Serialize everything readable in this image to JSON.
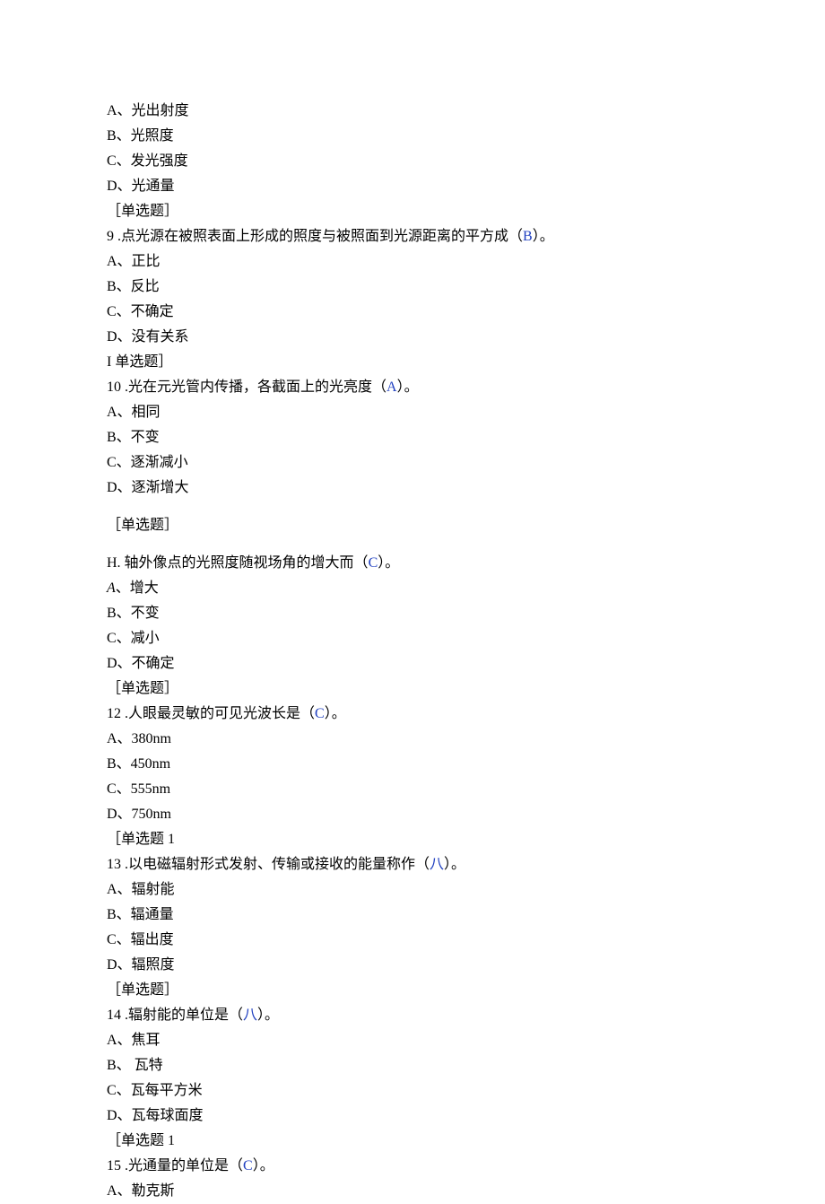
{
  "lines": [
    {
      "segments": [
        {
          "text": "A、光出射度"
        }
      ]
    },
    {
      "segments": [
        {
          "text": "B、光照度"
        }
      ]
    },
    {
      "segments": [
        {
          "text": "C、发光强度"
        }
      ]
    },
    {
      "segments": [
        {
          "text": "D、光通量"
        }
      ]
    },
    {
      "segments": [
        {
          "text": "［单选题］"
        }
      ]
    },
    {
      "segments": [
        {
          "text": "9 .点光源在被照表面上形成的照度与被照面到光源距离的平方成（"
        },
        {
          "text": "B",
          "blue": true
        },
        {
          "text": "）。"
        }
      ]
    },
    {
      "segments": [
        {
          "text": "A、正比"
        }
      ]
    },
    {
      "segments": [
        {
          "text": "B、反比"
        }
      ]
    },
    {
      "segments": [
        {
          "text": "C、不确定"
        }
      ]
    },
    {
      "segments": [
        {
          "text": "D、没有关系"
        }
      ]
    },
    {
      "segments": [
        {
          "text": "I 单选题］"
        }
      ]
    },
    {
      "segments": [
        {
          "text": "10 .光在元光管内传播，各截面上的光亮度（"
        },
        {
          "text": "A",
          "blue": true
        },
        {
          "text": "）。"
        }
      ]
    },
    {
      "segments": [
        {
          "text": "A、相同"
        }
      ]
    },
    {
      "segments": [
        {
          "text": "B、不变"
        }
      ]
    },
    {
      "segments": [
        {
          "text": "C、逐渐减小"
        }
      ]
    },
    {
      "segments": [
        {
          "text": "D、逐渐增大"
        }
      ]
    },
    {
      "gap": true,
      "segments": [
        {
          "text": "［单选题］"
        }
      ]
    },
    {
      "gap": true,
      "segments": [
        {
          "text": "H. 轴外像点的光照度随视场角的增大而（"
        },
        {
          "text": "C",
          "blue": true
        },
        {
          "text": "）。"
        }
      ]
    },
    {
      "segments": [
        {
          "text": "A",
          "italic": true
        },
        {
          "text": "、增大"
        }
      ]
    },
    {
      "segments": [
        {
          "text": "B、不变"
        }
      ]
    },
    {
      "segments": [
        {
          "text": "C、减小"
        }
      ]
    },
    {
      "segments": [
        {
          "text": "D、不确定"
        }
      ]
    },
    {
      "segments": [
        {
          "text": "［单选题］"
        }
      ]
    },
    {
      "segments": [
        {
          "text": "12 .人眼最灵敏的可见光波长是（"
        },
        {
          "text": "C",
          "blue": true
        },
        {
          "text": "）。"
        }
      ]
    },
    {
      "segments": [
        {
          "text": "A、380nm"
        }
      ]
    },
    {
      "segments": [
        {
          "text": "B、450nm"
        }
      ]
    },
    {
      "segments": [
        {
          "text": "C、555nm"
        }
      ]
    },
    {
      "segments": [
        {
          "text": "D、750nm"
        }
      ]
    },
    {
      "segments": [
        {
          "text": "［单选题 1"
        }
      ]
    },
    {
      "segments": [
        {
          "text": "13 .以电磁辐射形式发射、传输或接收的能量称作（"
        },
        {
          "text": "八",
          "blue": true
        },
        {
          "text": "）。"
        }
      ]
    },
    {
      "segments": [
        {
          "text": "A、辐射能"
        }
      ]
    },
    {
      "segments": [
        {
          "text": "B、辐通量"
        }
      ]
    },
    {
      "segments": [
        {
          "text": "C、辐出度"
        }
      ]
    },
    {
      "segments": [
        {
          "text": "D、辐照度"
        }
      ]
    },
    {
      "segments": [
        {
          "text": "［单选题］"
        }
      ]
    },
    {
      "segments": [
        {
          "text": "14 .辐射能的单位是（"
        },
        {
          "text": "八",
          "blue": true
        },
        {
          "text": "）。"
        }
      ]
    },
    {
      "segments": [
        {
          "text": "A、焦耳"
        }
      ]
    },
    {
      "segments": [
        {
          "text": "B、 瓦特"
        }
      ]
    },
    {
      "segments": [
        {
          "text": "C、瓦每平方米"
        }
      ]
    },
    {
      "segments": [
        {
          "text": "D、瓦每球面度"
        }
      ]
    },
    {
      "segments": [
        {
          "text": "［单选题 1"
        }
      ]
    },
    {
      "segments": [
        {
          "text": "15 .光通量的单位是（"
        },
        {
          "text": "C",
          "blue": true
        },
        {
          "text": "）。"
        }
      ]
    },
    {
      "segments": [
        {
          "text": "A、勒克斯"
        }
      ]
    }
  ]
}
